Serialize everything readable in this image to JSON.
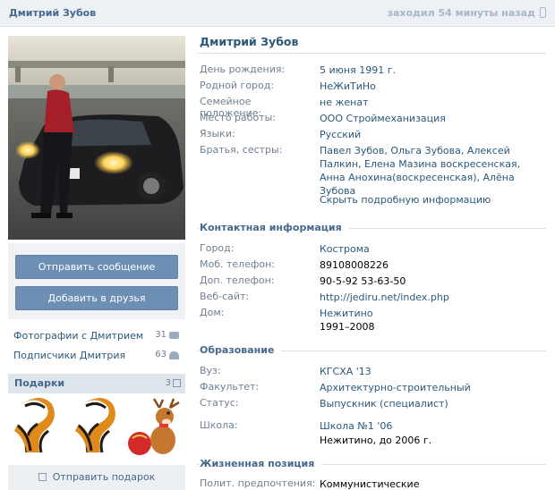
{
  "header": {
    "name": "Дмитрий Зубов",
    "status": "заходил 54 минуты назад"
  },
  "icons": [
    "phone-icon",
    "camera-icon",
    "people-icon",
    "gift-icon"
  ],
  "colors": {
    "header_bg": "#edf1f5",
    "link": "#2b587a",
    "button": "#6d8fb3",
    "label": "#707f90"
  },
  "actions": {
    "send_message": "Отправить сообщение",
    "add_friend": "Добавить в друзья"
  },
  "sidebar": {
    "photos_label": "Фотографии с Дмитрием",
    "photos_count": "31",
    "followers_label": "Подписчики Дмитрия",
    "followers_count": "63",
    "gifts_title": "Подарки",
    "gifts_count": "3",
    "send_gift": "Отправить подарок"
  },
  "profile": {
    "name": "Дмитрий Зубов",
    "birthday_k": "День рождения:",
    "birthday_v": "5 июня 1991 г.",
    "hometown_k": "Родной город:",
    "hometown_v": "НеЖиТиНо",
    "family_k": "Семейное положение:",
    "family_v": "не женат",
    "work_k": "Место работы:",
    "work_v": "ООО Строймеханизация",
    "lang_k": "Языки:",
    "lang_v": "Русский",
    "siblings_k": "Братья, сестры:",
    "siblings_v": "Павел Зубов, Ольга Зубова, Алексей Палкин, Елена Мазина воскресенская, Анна Анохина(воскресенская), Алёна Зубова",
    "hide_link": "Скрыть подробную информацию"
  },
  "contacts": {
    "title": "Контактная информация",
    "city_k": "Город:",
    "city_v": "Кострома",
    "mob_k": "Моб. телефон:",
    "mob_v": "89108008226",
    "extra_k": "Доп. телефон:",
    "extra_v": "90-5-92 53-63-50",
    "site_k": "Веб-сайт:",
    "site_v": "http://jediru.net/index.php",
    "home_k": "Дом:",
    "home_v1": "Нежитино",
    "home_v2": "1991–2008"
  },
  "education": {
    "title": "Образование",
    "uni_k": "Вуз:",
    "uni_v": "КГСХА '13",
    "faculty_k": "Факультет:",
    "faculty_v": "Архитектурно-строительный",
    "status_k": "Статус:",
    "status_v": "Выпускник (специалист)",
    "school_k": "Школа:",
    "school_v1": "Школа №1 '06",
    "school_v2": "Нежитино, до 2006 г."
  },
  "position": {
    "title": "Жизненная позиция",
    "politics_k": "Полит. предпочтения:",
    "politics_v": "Коммунистические"
  }
}
